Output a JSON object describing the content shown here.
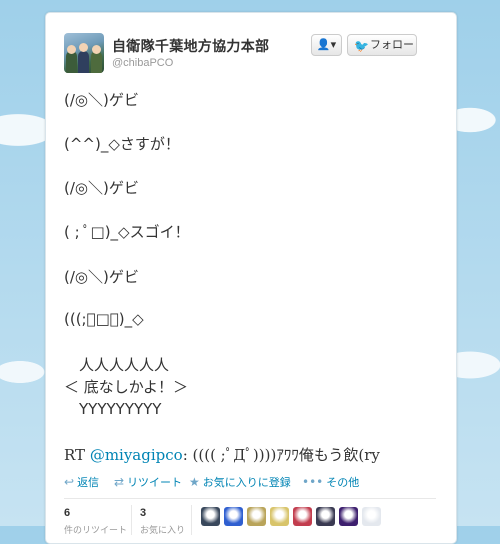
{
  "profile": {
    "display_name": "自衛隊千葉地方協力本部",
    "screen_name": "@chibaPCO"
  },
  "buttons": {
    "user_icon_label": "👤▾",
    "follow_label": "フォロー"
  },
  "tweet": {
    "lines": [
      "(/◎＼)ゲビ",
      "(^^)_◇さすが！",
      "(/◎＼)ゲビ",
      "( ; ﾟ□)_◇スゴイ！",
      "(/◎＼)ゲビ",
      "(((;ﾟ□ﾟ)_◇",
      "　人人人人人人",
      "＜ 底なしかよ！＞",
      "　YYYYYYYYY"
    ],
    "rt_prefix": "RT ",
    "mention": "@miyagipco",
    "rt_suffix": ": (((( ;ﾟДﾟ))))ｱﾜﾜ俺もう飲(ry"
  },
  "actions": {
    "reply": "返信",
    "retweet": "リツイート",
    "favorite": "お気に入りに登録",
    "more": "その他"
  },
  "stats": {
    "retweets_count": "6",
    "retweets_label": "件のリツイート",
    "favorites_count": "3",
    "favorites_label": "お気に入り"
  },
  "favoriters": [
    {
      "color": "#39485c"
    },
    {
      "color": "#2f5fd0"
    },
    {
      "color": "#b9a45a"
    },
    {
      "color": "#d8c46a"
    },
    {
      "color": "#c23d4e"
    },
    {
      "color": "#3a3a52"
    },
    {
      "color": "#3d1f6e"
    },
    {
      "color": "#e4e8ee"
    }
  ]
}
